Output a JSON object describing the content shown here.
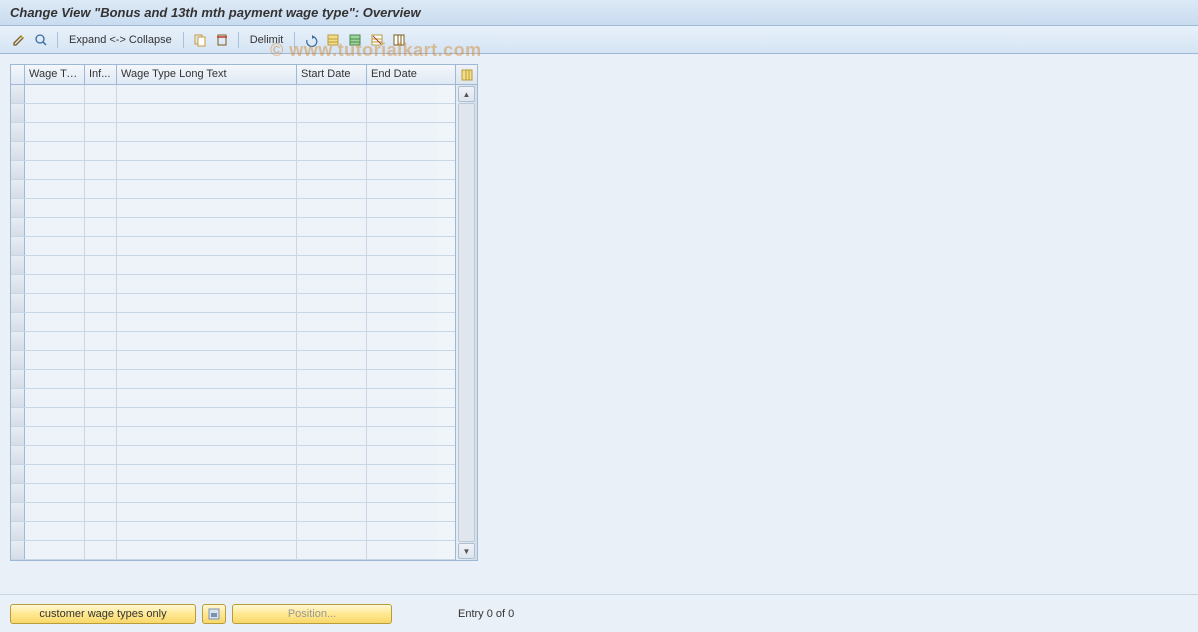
{
  "title": "Change View \"Bonus and 13th mth payment wage type\": Overview",
  "toolbar": {
    "expand_collapse": "Expand <-> Collapse",
    "delimit": "Delimit"
  },
  "table": {
    "headers": {
      "wage_type": "Wage Ty...",
      "inf": "Inf...",
      "long_text": "Wage Type Long Text",
      "start_date": "Start Date",
      "end_date": "End Date"
    },
    "row_count": 25
  },
  "footer": {
    "customer_btn": "customer wage types only",
    "position_btn": "Position...",
    "entry_status": "Entry 0 of 0"
  },
  "watermark": "© www.tutorialkart.com"
}
